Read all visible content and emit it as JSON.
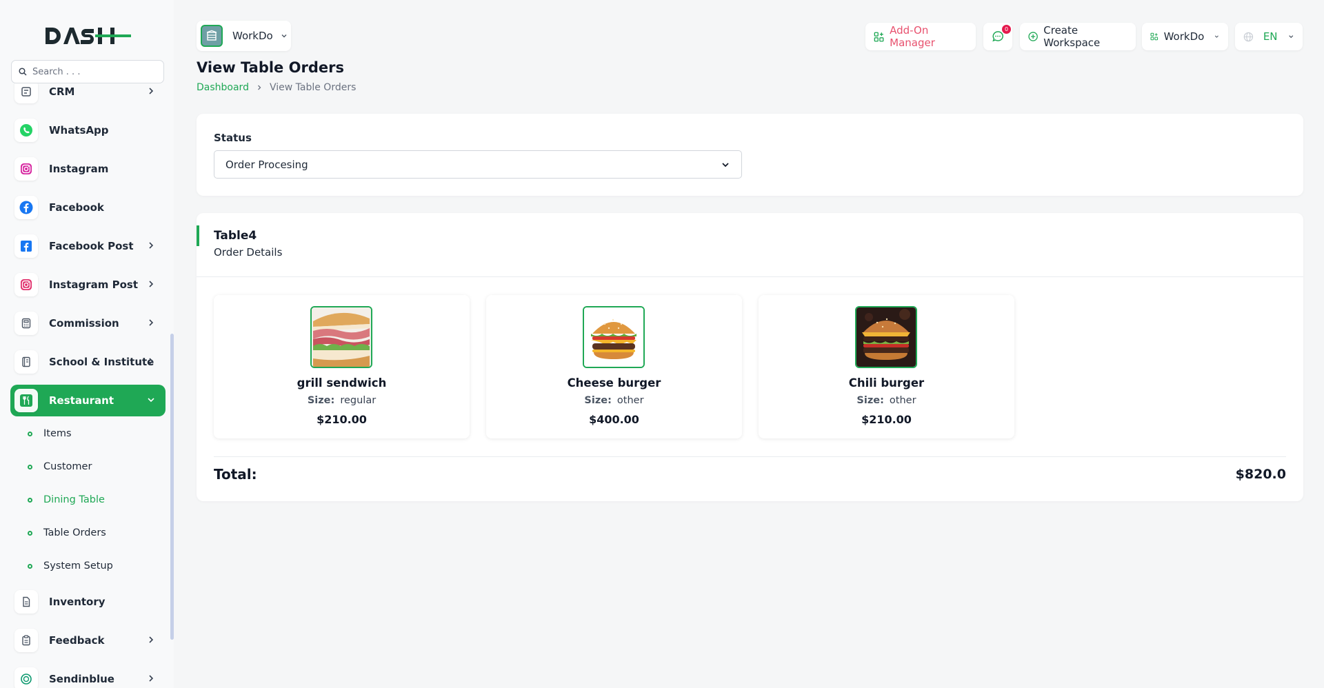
{
  "brand": {
    "logo_text": "DASH",
    "accent": "#1fa855"
  },
  "search": {
    "placeholder": "Search . . ."
  },
  "sidebar": {
    "items": [
      {
        "label": "CRM",
        "icon": "crm-icon",
        "has_submenu": true
      },
      {
        "label": "WhatsApp",
        "icon": "whatsapp-icon",
        "has_submenu": false
      },
      {
        "label": "Instagram",
        "icon": "instagram-icon",
        "has_submenu": false
      },
      {
        "label": "Facebook",
        "icon": "facebook-icon",
        "has_submenu": false
      },
      {
        "label": "Facebook Post",
        "icon": "facebook-post-icon",
        "has_submenu": true
      },
      {
        "label": "Instagram Post",
        "icon": "instagram-post-icon",
        "has_submenu": true
      },
      {
        "label": "Commission",
        "icon": "calculator-icon",
        "has_submenu": true
      },
      {
        "label": "School & Institute",
        "icon": "book-icon",
        "has_submenu": true
      },
      {
        "label": "Restaurant",
        "icon": "restaurant-icon",
        "has_submenu": true,
        "active": true
      },
      {
        "label": "Inventory",
        "icon": "document-icon",
        "has_submenu": false
      },
      {
        "label": "Feedback",
        "icon": "clipboard-icon",
        "has_submenu": true
      },
      {
        "label": "Sendinblue",
        "icon": "sendinblue-icon",
        "has_submenu": true
      }
    ],
    "restaurant_sub": [
      {
        "label": "Items"
      },
      {
        "label": "Customer"
      },
      {
        "label": "Dining Table",
        "current": true
      },
      {
        "label": "Table Orders"
      },
      {
        "label": "System Setup"
      }
    ]
  },
  "topbar": {
    "workspace_label": "WorkDo",
    "addon_label": "Add-On Manager",
    "notification_count": "0",
    "create_workspace_label": "Create Workspace",
    "workspace_menu_label": "WorkDo",
    "language_label": "EN"
  },
  "header": {
    "title": "View Table Orders",
    "breadcrumb": {
      "home": "Dashboard",
      "current": "View Table Orders"
    }
  },
  "status": {
    "label": "Status",
    "selected": "Order Procesing"
  },
  "order": {
    "table_name": "Table4",
    "subtitle": "Order Details",
    "items": [
      {
        "name": "grill sendwich",
        "size_key": "Size:",
        "size": "regular",
        "price": "$210.00",
        "image": "sandwich-image"
      },
      {
        "name": "Cheese burger",
        "size_key": "Size:",
        "size": "other",
        "price": "$400.00",
        "image": "cheeseburger-image"
      },
      {
        "name": "Chili burger",
        "size_key": "Size:",
        "size": "other",
        "price": "$210.00",
        "image": "chili-burger-image"
      }
    ],
    "total_label": "Total:",
    "total_value": "$820.0"
  }
}
